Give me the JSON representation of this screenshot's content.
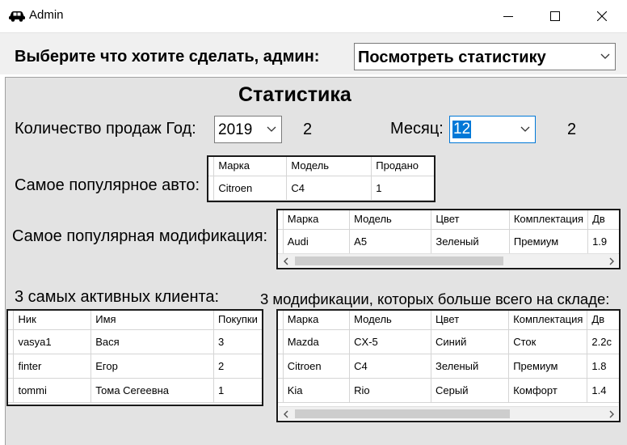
{
  "window": {
    "title": "Admin"
  },
  "selector": {
    "label": "Выберите что хотите сделать, админ:",
    "value": "Посмотреть статистику"
  },
  "stats": {
    "heading": "Статистика",
    "sales_label": "Количество продаж Год:",
    "year_value": "2019",
    "year_count": "2",
    "month_label": "Месяц:",
    "month_value": "12",
    "month_count": "2"
  },
  "popular_car": {
    "label": "Самое популярное авто:",
    "columns": [
      "Марка",
      "Модель",
      "Продано"
    ],
    "rows": [
      [
        "Citroen",
        "C4",
        "1"
      ]
    ]
  },
  "popular_mod": {
    "label": "Самое популярная модификация:",
    "columns": [
      "Марка",
      "Модель",
      "Цвет",
      "Комплектация",
      "Дв"
    ],
    "rows": [
      [
        "Audi",
        "A5",
        "Зеленый",
        "Премиум",
        "1.9"
      ]
    ]
  },
  "active_clients": {
    "label": "3 самых активных клиента:",
    "columns": [
      "Ник",
      "Имя",
      "Покупки"
    ],
    "rows": [
      [
        "vasya1",
        "Вася",
        "3"
      ],
      [
        "finter",
        "Егор",
        "2"
      ],
      [
        "tommi",
        "Тома Сегеевна",
        "1"
      ]
    ]
  },
  "stock_mods": {
    "label": "3 модификации, которых больше всего на складе:",
    "columns": [
      "Марка",
      "Модель",
      "Цвет",
      "Комплектация",
      "Дв"
    ],
    "rows": [
      [
        "Mazda",
        "CX-5",
        "Синий",
        "Сток",
        "2.2c"
      ],
      [
        "Citroen",
        "C4",
        "Зеленый",
        "Премиум",
        "1.8"
      ],
      [
        "Kia",
        "Rio",
        "Серый",
        "Комфорт",
        "1.4"
      ]
    ]
  },
  "icons": {
    "app": "car-icon",
    "minimize": "minimize-icon",
    "maximize": "maximize-icon",
    "close": "close-icon",
    "dropdown": "chevron-down-icon"
  },
  "colors": {
    "panel_bg": "#e3e3e3",
    "selected_text_bg": "#0078d7",
    "focus_border": "#0078d7"
  }
}
